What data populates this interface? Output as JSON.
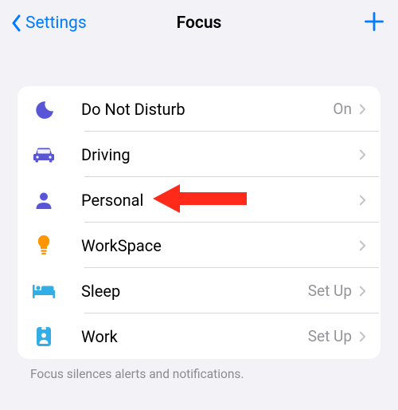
{
  "nav": {
    "back_label": "Settings",
    "title": "Focus"
  },
  "colors": {
    "accent": "#007aff",
    "purple": "#5856d6",
    "orange": "#ff9500",
    "teal": "#32ade6",
    "arrow": "#ff2a1a",
    "chevron": "#c5c5c9",
    "muted": "#93939a"
  },
  "rows": [
    {
      "icon": "moon",
      "label": "Do Not Disturb",
      "status": "On",
      "icon_name": "moon-icon"
    },
    {
      "icon": "car",
      "label": "Driving",
      "status": "",
      "icon_name": "car-icon"
    },
    {
      "icon": "person",
      "label": "Personal",
      "status": "",
      "icon_name": "person-icon"
    },
    {
      "icon": "bulb",
      "label": "WorkSpace",
      "status": "",
      "icon_name": "lightbulb-icon"
    },
    {
      "icon": "bed",
      "label": "Sleep",
      "status": "Set Up",
      "icon_name": "bed-icon"
    },
    {
      "icon": "badge",
      "label": "Work",
      "status": "Set Up",
      "icon_name": "badge-icon"
    }
  ],
  "footer": "Focus silences alerts and notifications.",
  "annotation_arrow_target_row": 2
}
